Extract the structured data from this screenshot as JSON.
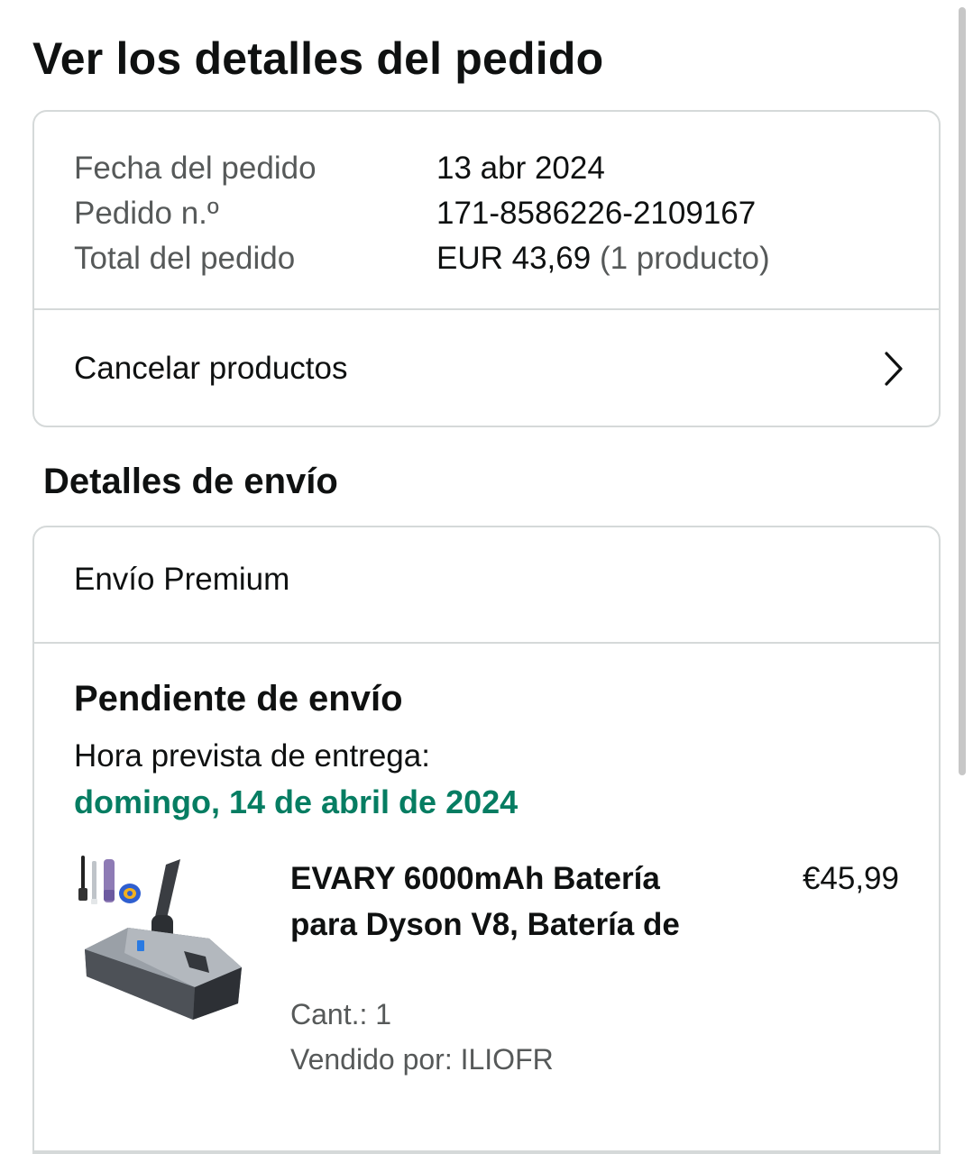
{
  "page": {
    "title": "Ver los detalles del pedido"
  },
  "summary": {
    "order_date_label": "Fecha del pedido",
    "order_date_value": "13 abr 2024",
    "order_number_label": "Pedido n.º",
    "order_number_value": "171-8586226-2109167",
    "order_total_label": "Total del pedido",
    "order_total_value": "EUR 43,69",
    "order_total_items": "(1 producto)",
    "cancel_label": "Cancelar productos",
    "cancel_icon": "chevron-right-icon"
  },
  "shipping": {
    "section_title": "Detalles de envío",
    "method": "Envío Premium",
    "status": "Pendiente de envío",
    "delivery_label": "Hora prevista de entrega:",
    "delivery_date": "domingo, 14 de abril de 2024",
    "delivery_date_color": "#067d62"
  },
  "product": {
    "title": "EVARY 6000mAh Batería para Dyson V8, Batería de",
    "price": "€45,99",
    "quantity": "Cant.: 1",
    "seller": "Vendido por: ILIOFR",
    "image_icon": "vacuum-battery-product-image"
  }
}
